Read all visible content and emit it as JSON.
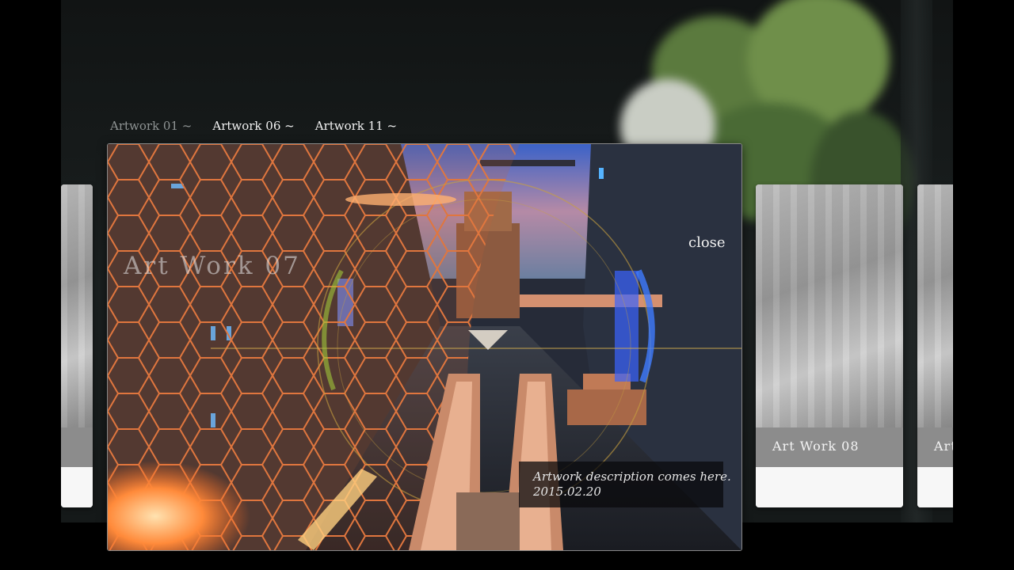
{
  "nav": {
    "tabs": [
      {
        "label": "Artwork 01 ~",
        "state": "dim"
      },
      {
        "label": "Artwork 06 ~",
        "state": "active"
      },
      {
        "label": "Artwork 11 ~",
        "state": "active"
      }
    ]
  },
  "viewer": {
    "title": "Art Work 07",
    "close_label": "close",
    "description": "Artwork description comes here.",
    "date": "2015.02.20"
  },
  "cards": [
    {
      "label": ""
    },
    {
      "label": "Art Work 08"
    },
    {
      "label": "Art"
    }
  ],
  "colors": {
    "hex_grid": "#e0763e",
    "hud_blue": "#3f7cff",
    "card_strip": "#8c8c8c"
  },
  "icons": [
    "close-text-button"
  ]
}
